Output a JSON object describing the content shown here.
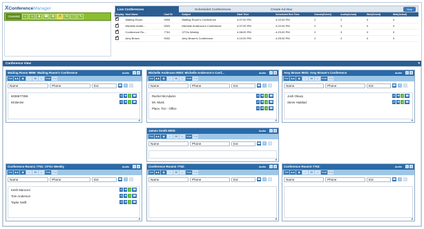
{
  "app": {
    "logo_mark": "X",
    "logo_text_1": "Conference",
    "logo_text_2": "Manager",
    "toolbar": {
      "connected_label": "Connected",
      "icons": [
        "home-icon",
        "person-icon",
        "users-icon",
        "phone-icon",
        "gear-icon",
        "question-icon",
        "mail-icon",
        "lock-icon",
        "pencil-icon"
      ]
    }
  },
  "conferences": {
    "tabs": [
      "Live Conferences",
      "Scheduled Conferences",
      "Create Ad Hoc"
    ],
    "active_tab": 0,
    "help_label": "Help",
    "columns": [
      "Display",
      "Host Name",
      "Conf ID",
      "Subject",
      "Start Time",
      "Scheduled End Time",
      "Guests(Sched)",
      "Audio(Actual)",
      "Web(Sched)",
      "Web(Actual)"
    ],
    "rows": [
      {
        "host": "Waiting Room",
        "id": "9999",
        "subject": "Waiting Room's Conference",
        "start": "4:07:00 PM",
        "end": "4:22:00 PM",
        "c1": "2",
        "c2": "2",
        "c3": "0",
        "c4": "0"
      },
      {
        "host": "Michelle Ander...",
        "id": "9003",
        "subject": "Michelle Anderson's Conference",
        "start": "4:07:00 PM",
        "end": "4:22:00 PM",
        "c1": "2",
        "c2": "3",
        "c3": "0",
        "c4": "0"
      },
      {
        "host": "Conference Ro...",
        "id": "7761",
        "subject": "CFOs Weekly",
        "start": "4:08:00 PM",
        "end": "4:23:00 PM",
        "c1": "2",
        "c2": "3",
        "c3": "0",
        "c4": "0"
      },
      {
        "host": "Amy Brown",
        "id": "9002",
        "subject": "Amy Brown's Conference",
        "start": "4:10:00 PM",
        "end": "4:25:00 PM",
        "c1": "2",
        "c2": "2",
        "c3": "0",
        "c4": "0"
      }
    ]
  },
  "conference_view": {
    "title": "Conference View",
    "panel_labels": {
      "audio": "Audio",
      "name_ph": "Name",
      "phone_ph": "Phone",
      "ext_ph": "Ext",
      "tool_dial": "Dial",
      "tool_mute": "Mute",
      "tool_end": "End",
      "actions": [
        "mute-icon",
        "hold-icon",
        "music-icon",
        "hangup-icon"
      ]
    },
    "panels": [
      {
        "title": "Waiting Room 9999: Waiting Room's Conference",
        "participants": [
          "6036577359",
          "Mr.Becke"
        ]
      },
      {
        "title": "Michelle Anderson 9003: Michelle Anderson's Conf...",
        "participants": [
          "Rachel McAdams",
          "Mr. Musk",
          "Place, Tori - Office"
        ]
      },
      {
        "title": "Amy Brown 9002: Amy Brown's Conference",
        "participants": [
          "Josh Okuey",
          "Steve Haddad"
        ]
      },
      {
        "title": "James Smith 9000:",
        "participants": []
      },
      {
        "title": "Conference Room1 7761: CFOs Weekly",
        "participants": [
          "Keith Manzoni",
          "Tom Anderson",
          "Taylor Swift"
        ]
      },
      {
        "title": "Conference Room2 7762:",
        "participants": []
      },
      {
        "title": "Conference Room3 7763:",
        "participants": []
      }
    ]
  }
}
